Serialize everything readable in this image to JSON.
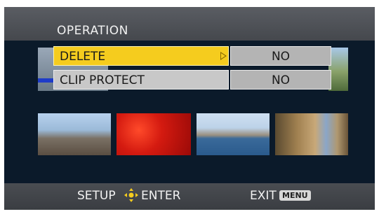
{
  "header": {
    "title": "OPERATION"
  },
  "menu": {
    "items": [
      {
        "label": "DELETE",
        "value": "NO",
        "selected": true
      },
      {
        "label": "CLIP PROTECT",
        "value": "NO",
        "selected": false
      }
    ]
  },
  "footer": {
    "setup_label": "SETUP",
    "enter_label": "ENTER",
    "exit_label": "EXIT",
    "menu_key": "MENU"
  },
  "colors": {
    "highlight": "#f5cc1e",
    "panel_bg": "#0b1a2a",
    "bar_bg": "#4a4d52",
    "value_bg": "#b4b4b4"
  },
  "icons": {
    "enter": "joystick-cross-icon",
    "submenu": "triangle-right-icon"
  }
}
